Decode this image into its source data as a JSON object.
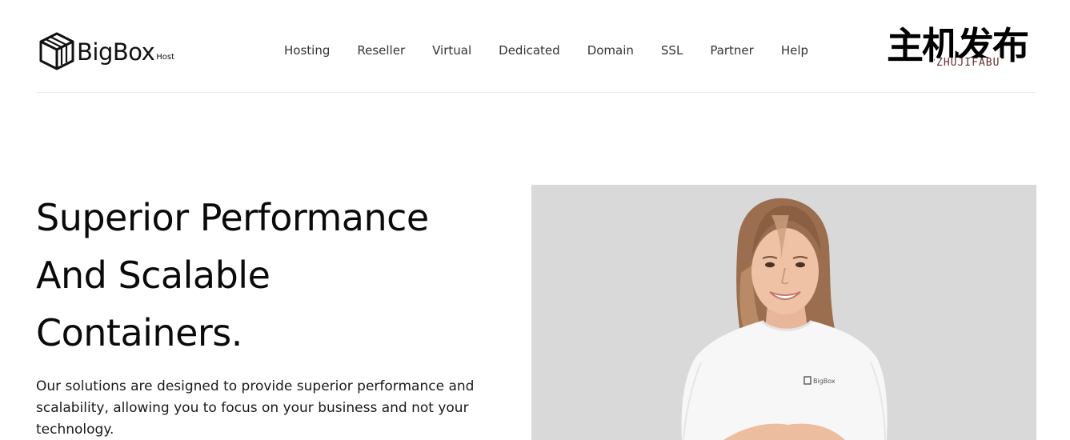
{
  "header": {
    "logo": {
      "brand": "BigBox",
      "suffix": "Host"
    },
    "nav": [
      {
        "label": "Hosting"
      },
      {
        "label": "Reseller"
      },
      {
        "label": "Virtual"
      },
      {
        "label": "Dedicated"
      },
      {
        "label": "Domain"
      },
      {
        "label": "SSL"
      },
      {
        "label": "Partner"
      },
      {
        "label": "Help"
      }
    ],
    "watermark": {
      "main": "主机发布",
      "sub": "ZHUJIFABU"
    }
  },
  "hero": {
    "title_lines": [
      "Superior Performance",
      "And Scalable",
      "Containers."
    ],
    "description": "Our solutions are designed to provide superior performance and scalability, allowing you to focus on your business and not your technology.",
    "image": {
      "shirt_logo": "BigBox",
      "background_color": "#d9d9d9"
    }
  }
}
